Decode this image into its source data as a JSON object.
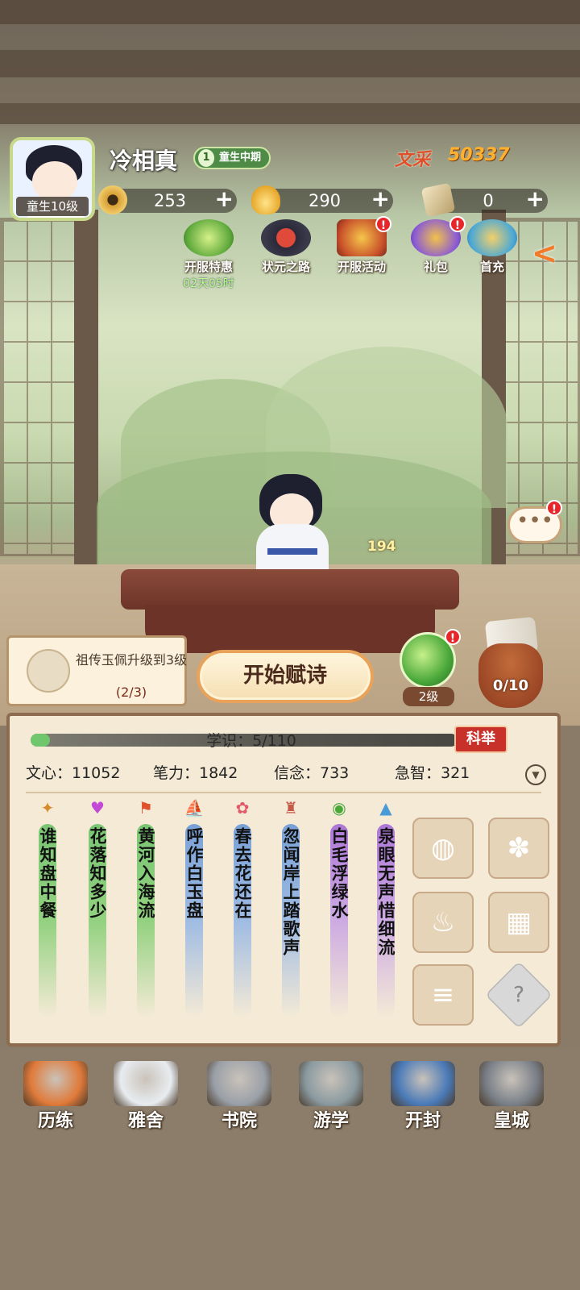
{
  "player": {
    "name": "冷相真",
    "level_label": "童生10级",
    "rank_number": "1",
    "rank_label": "童生中期",
    "wencai_label": "文采",
    "wencai_value": "50337"
  },
  "resources": [
    {
      "icon": "copper-coin-icon",
      "amount": "253",
      "add": "+"
    },
    {
      "icon": "gold-ingot-icon",
      "amount": "290",
      "add": "+"
    },
    {
      "icon": "ticket-icon",
      "amount": "0",
      "add": "+"
    }
  ],
  "events": [
    {
      "label": "开服特惠",
      "timer": "02天05时",
      "icon": "gift-box-icon",
      "badge": ""
    },
    {
      "label": "状元之路",
      "icon": "official-hat-icon",
      "badge": ""
    },
    {
      "label": "开服活动",
      "icon": "treasure-chest-icon",
      "badge": "!"
    },
    {
      "label": "礼包",
      "icon": "gift-bag-icon",
      "badge": "!"
    },
    {
      "label": "首充",
      "icon": "first-recharge-icon",
      "badge": ""
    }
  ],
  "collapse_arrow": "<",
  "chat": {
    "icon": "chat-bubble-icon",
    "text": "•••",
    "badge": "!"
  },
  "scene": {
    "paper_count": "194"
  },
  "quest": {
    "title": "祖传玉佩升级到3级",
    "progress": "(2/3)"
  },
  "start_button": "开始赋诗",
  "jade": {
    "level": "2级",
    "badge": "!"
  },
  "jar": {
    "count": "0/10"
  },
  "panel": {
    "xp_label": "学识：5/110",
    "xp_fraction": 0.045,
    "exam_button": "科举",
    "stats": [
      {
        "label": "文心：11052"
      },
      {
        "label": "笔力：1842"
      },
      {
        "label": "信念：733"
      },
      {
        "label": "急智：321"
      }
    ],
    "stat_toggle_icon": "chevron-down-icon",
    "poems": [
      {
        "icon": "leaf-icon",
        "glyph": "✦",
        "color": "#d88a2a",
        "tint": "g",
        "text": "谁知盘中餐"
      },
      {
        "icon": "heart-icon",
        "glyph": "♥",
        "color": "#c24ad6",
        "tint": "g",
        "text": "花落知多少"
      },
      {
        "icon": "flag-icon",
        "glyph": "⚑",
        "color": "#e0502a",
        "tint": "g",
        "text": "黄河入海流"
      },
      {
        "icon": "sailboat-icon",
        "glyph": "⛵",
        "color": "#e0a82a",
        "tint": "b",
        "text": "呼作白玉盘"
      },
      {
        "icon": "lotus-icon",
        "glyph": "✿",
        "color": "#e05a6a",
        "tint": "b",
        "text": "春去花还在"
      },
      {
        "icon": "tower-icon",
        "glyph": "♜",
        "color": "#c65a4a",
        "tint": "b",
        "text": "忽闻岸上踏歌声"
      },
      {
        "icon": "bowl-icon",
        "glyph": "◉",
        "color": "#4aa83a",
        "tint": "p",
        "text": "白毛浮绿水"
      },
      {
        "icon": "mountain-icon",
        "glyph": "▲",
        "color": "#4a9ad6",
        "tint": "p",
        "text": "泉眼无声惜细流"
      }
    ],
    "slots": [
      {
        "icon": "ink-stone-icon",
        "glyph": "◍"
      },
      {
        "icon": "paw-icon",
        "glyph": "✽"
      },
      {
        "icon": "incense-burner-icon",
        "glyph": "♨"
      },
      {
        "icon": "grid-icon",
        "glyph": "▦"
      },
      {
        "icon": "scroll-icon",
        "glyph": "≡"
      },
      {
        "icon": "unknown-icon",
        "glyph": "?"
      }
    ]
  },
  "nav": [
    {
      "label": "历练",
      "icon": "fan-brush-icon",
      "color": "#e07a3a"
    },
    {
      "label": "雅舍",
      "icon": "teapot-icon",
      "color": "#e8ecf0"
    },
    {
      "label": "书院",
      "icon": "academy-gate-icon",
      "color": "#9aa0a8"
    },
    {
      "label": "游学",
      "icon": "mountains-icon",
      "color": "#8a9aa0"
    },
    {
      "label": "开封",
      "icon": "city-gate-icon",
      "color": "#4a7ab8"
    },
    {
      "label": "皇城",
      "icon": "dragon-statue-icon",
      "color": "#7a8088"
    }
  ]
}
